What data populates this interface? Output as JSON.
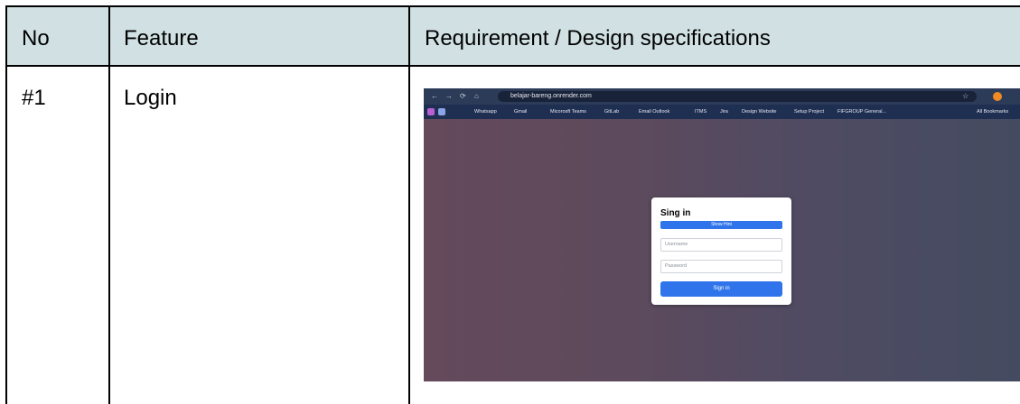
{
  "table": {
    "headers": [
      "No",
      "Feature",
      "Requirement / Design specifications"
    ],
    "row": {
      "no": "#1",
      "feature": "Login"
    }
  },
  "browser": {
    "url": "belajar-bareng.onrender.com",
    "bookmarks": [
      "Whatsapp",
      "Gmail",
      "Micorosft Teams",
      "GitLab",
      "Email Outlook",
      "ITMS",
      "Jira",
      "Design Website",
      "Setup Project",
      "FIFGROUP General...",
      "All Bookmarks"
    ]
  },
  "signin": {
    "title": "Sing in",
    "hint_label": "Show Hint",
    "username_placeholder": "Username",
    "password_placeholder": "Password",
    "submit_label": "Sign in"
  },
  "colors": {
    "header_bg": "#d0e0e3",
    "primary": "#2f74eb"
  }
}
